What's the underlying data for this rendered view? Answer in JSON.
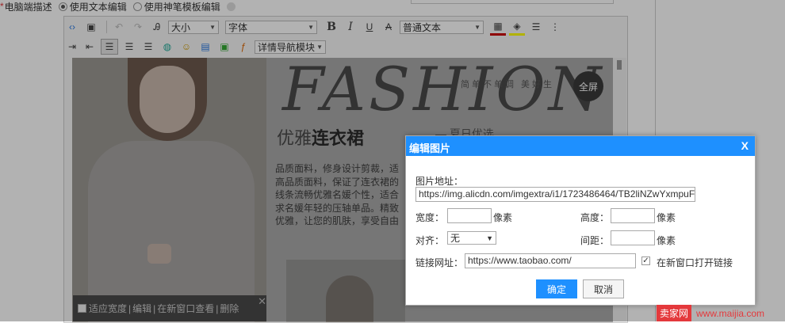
{
  "form": {
    "field_label": "电脑端描述",
    "option_text_editor": "使用文本编辑",
    "option_template_editor": "使用神笔模板编辑"
  },
  "toolbar": {
    "font_size": "大小",
    "font_family": "字体",
    "paragraph_format": "普通文本",
    "bold": "B",
    "italic": "I",
    "underline": "U",
    "strikethrough": "A",
    "detail_nav_module": "详情导航模块"
  },
  "content_image": {
    "fashion_word": "FASHION",
    "tagline": "简单不单调   美好生",
    "headline_prefix": "优雅",
    "headline_bold": "连衣裙",
    "subline": "— 夏日优选",
    "paragraph": "品质面料，修身设计剪裁，适高品质面料，保证了连衣裙的线条流畅优雅名媛个性，适合求名媛年轻的压轴单品。精致优雅，让您的肌肤，享受自由",
    "fullscreen_label": "全屏"
  },
  "image_toolbar": {
    "fit_width": "适应宽度",
    "sep": "|",
    "edit": "编辑",
    "open_new_window": "在新窗口查看",
    "delete": "删除",
    "close": "✕"
  },
  "dialog": {
    "title": "编辑图片",
    "close": "X",
    "image_url_label": "图片地址：",
    "image_url_value": "https://img.alicdn.com/imgextra/i1/1723486464/TB2liNZwYxmpuF",
    "width_label": "宽度：",
    "width_value": "",
    "width_unit": "像素",
    "height_label": "高度：",
    "height_value": "",
    "height_unit": "像素",
    "align_label": "对齐：",
    "align_value": "无",
    "spacing_label": "间距：",
    "spacing_value": "",
    "spacing_unit": "像素",
    "link_label": "链接网址：",
    "link_value": "https://www.taobao.com/",
    "new_window_checked": true,
    "new_window_label": "在新窗口打开链接",
    "ok_button": "确定",
    "cancel_button": "取消"
  },
  "watermark": {
    "logo_text": "卖家网",
    "url": "www.maijia.com"
  },
  "colors": {
    "accent": "#1e90ff",
    "watermark_red": "#e4393c"
  }
}
